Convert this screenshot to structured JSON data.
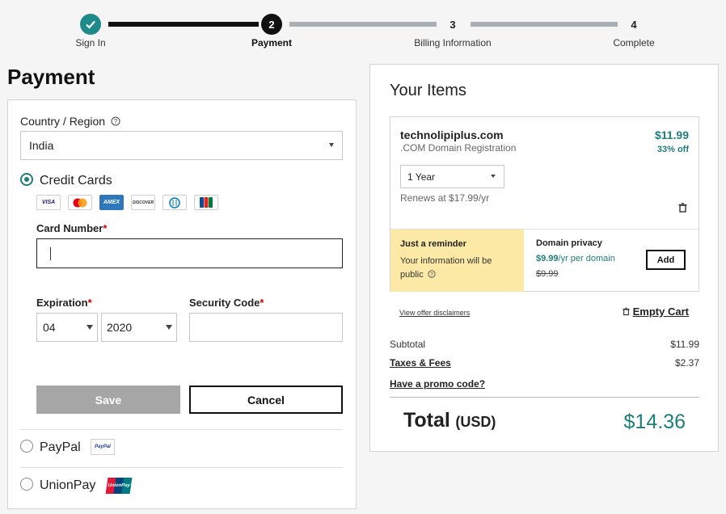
{
  "stepper": {
    "steps": [
      {
        "number": "",
        "label": "Sign In",
        "state": "done"
      },
      {
        "number": "2",
        "label": "Payment",
        "state": "current"
      },
      {
        "number": "3",
        "label": "Billing Information",
        "state": "upcoming"
      },
      {
        "number": "4",
        "label": "Complete",
        "state": "upcoming"
      }
    ]
  },
  "page_title": "Payment",
  "payment_form": {
    "country_label": "Country / Region",
    "country_value": "India",
    "credit_cards_label": "Credit Cards",
    "card_logos": [
      "VISA",
      "mastercard",
      "AMEX",
      "DISCOVER",
      "diners",
      "JCB"
    ],
    "card_number_label": "Card Number",
    "expiration_label": "Expiration",
    "expiration_month": "04",
    "expiration_year": "2020",
    "security_code_label": "Security Code",
    "required_mark": "*",
    "save_label": "Save",
    "cancel_label": "Cancel",
    "paypal_label": "PayPal",
    "paypal_logo_text": "PayPal",
    "unionpay_label": "UnionPay",
    "unionpay_logo_text": "UnionPay"
  },
  "cart": {
    "title": "Your Items",
    "item": {
      "name": "technolipiplus.com",
      "description": ".COM Domain Registration",
      "price": "$11.99",
      "discount": "33% off",
      "term": "1 Year",
      "renews": "Renews at $17.99/yr"
    },
    "reminder": {
      "title": "Just a reminder",
      "text": "Your information will be public"
    },
    "privacy": {
      "title": "Domain privacy",
      "price": "$9.99",
      "price_suffix": "/yr per domain",
      "old_price": "$9.99",
      "add_label": "Add"
    },
    "disclaimer_link": "View offer disclaimers",
    "empty_cart": "Empty Cart",
    "subtotal_label": "Subtotal",
    "subtotal_value": "$11.99",
    "taxes_label": "Taxes & Fees",
    "taxes_value": "$2.37",
    "promo_link": "Have a promo code?",
    "total_label": "Total",
    "total_currency": "(USD)",
    "total_value": "$14.36"
  },
  "colors": {
    "accent": "#1f7d7d",
    "step_done": "#1f8a8a",
    "reminder_bg": "#fde9a6"
  },
  "icons": [
    "check-icon",
    "help-icon",
    "trash-icon",
    "chevron-down-icon"
  ]
}
